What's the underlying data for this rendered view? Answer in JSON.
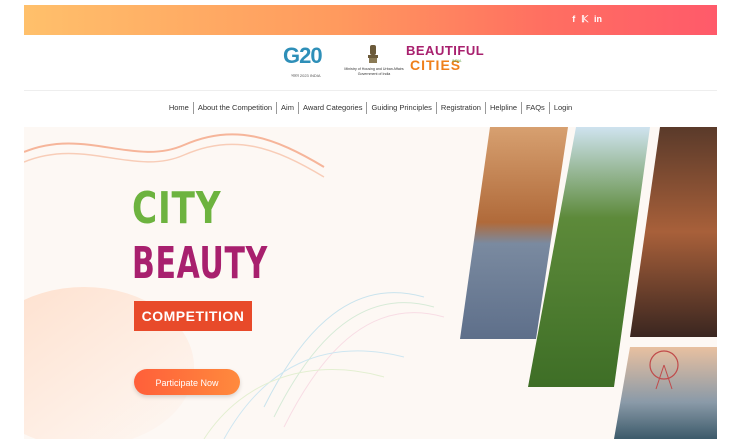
{
  "social": {
    "facebook": "f",
    "twitter": "𝕂",
    "linkedin": "in"
  },
  "logos": {
    "g20": "G20",
    "g20_sub": "भारत 2023 INDIA",
    "ministry": "Ministry of Housing and Urban Affairs",
    "ministry_sub": "Government of India",
    "bc_line1": "BEAUTIFUL",
    "bc_line2": "CITIES",
    "bc_tag": "INDIA"
  },
  "nav": [
    "Home",
    "About the Competition",
    "Aim",
    "Award Categories",
    "Guiding Principles",
    "Registration",
    "Helpline",
    "FAQs",
    "Login"
  ],
  "hero": {
    "title_line1": "CITY",
    "title_line2": "BEAUTY",
    "title_line3": "COMPETITION",
    "cta": "Participate Now"
  },
  "colors": {
    "topbar_start": "#ffc06b",
    "topbar_end": "#ff5a6a",
    "city_green": "#6db33f",
    "beauty_magenta": "#a8206e",
    "competition_red": "#e84a2a",
    "cta_orange": "#ff6b3a"
  }
}
